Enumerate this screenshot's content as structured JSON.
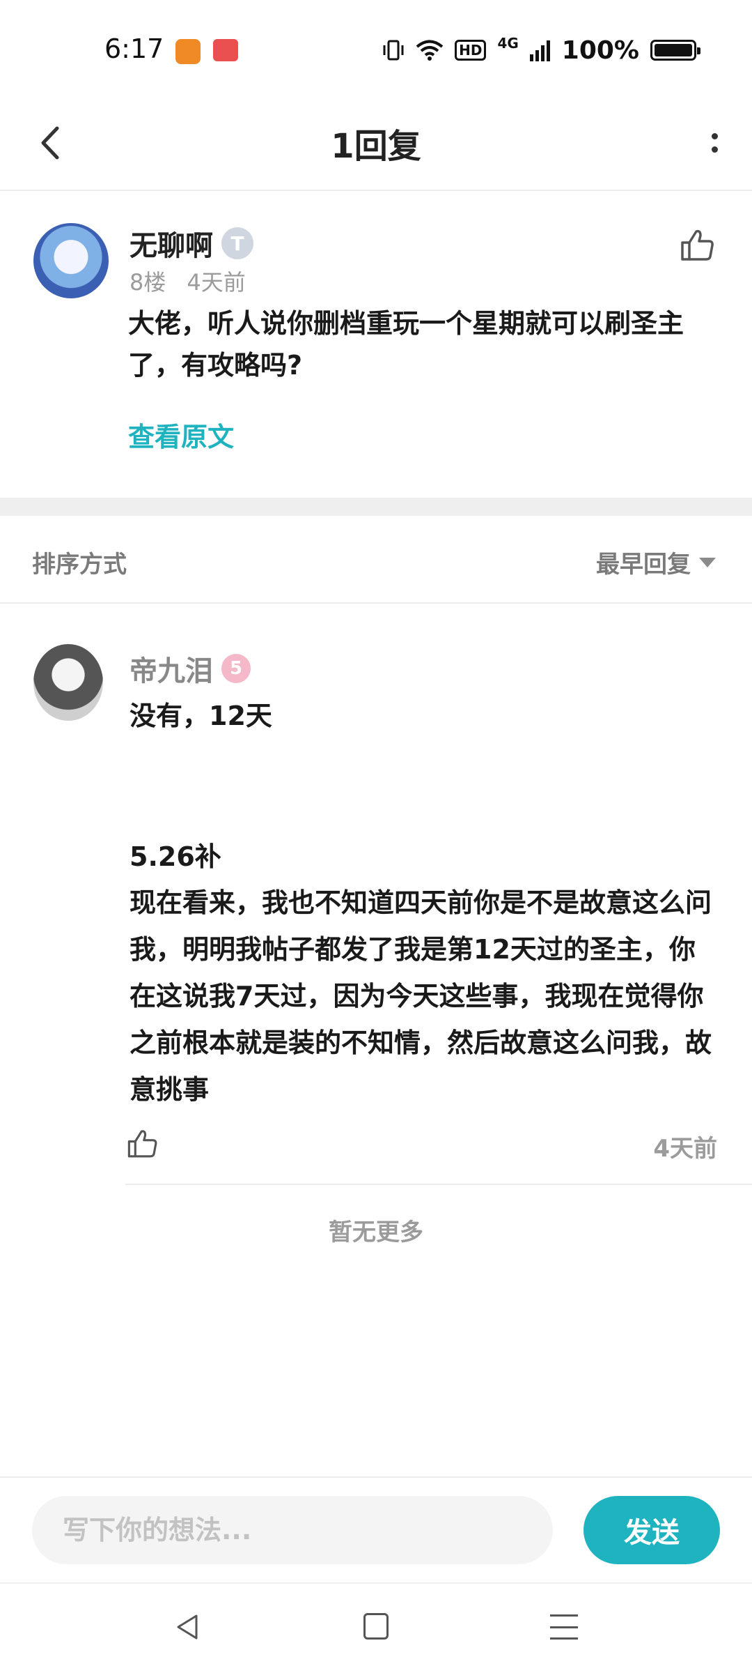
{
  "status_bar": {
    "time": "6:17",
    "hd": "HD",
    "network": "4G",
    "battery": "100%"
  },
  "header": {
    "title": "1回复"
  },
  "post": {
    "author": "无聊啊",
    "level_badge": "T",
    "floor": "8楼",
    "time": "4天前",
    "content": "大佬，听人说你删档重玩一个星期就可以刷圣主了，有攻略吗?",
    "view_original": "查看原文"
  },
  "sort": {
    "label": "排序方式",
    "value": "最早回复"
  },
  "reply": {
    "author": "帝九泪",
    "level_badge": "5",
    "line1": "没有，12天",
    "line2": "5.26补",
    "body": "现在看来，我也不知道四天前你是不是故意这么问我，明明我帖子都发了我是第12天过的圣主，你在这说我7天过，因为今天这些事，我现在觉得你之前根本就是装的不知情，然后故意这么问我，故意挑事",
    "time": "4天前"
  },
  "footer_note": "暂无更多",
  "input": {
    "placeholder": "写下你的想法..."
  },
  "send_label": "发送",
  "colors": {
    "accent": "#1fb3c0",
    "meta_text": "#9b9b9b"
  },
  "icons": {
    "back": "chevron-left-icon",
    "more": "more-vertical-icon",
    "like": "thumbs-up-icon"
  }
}
